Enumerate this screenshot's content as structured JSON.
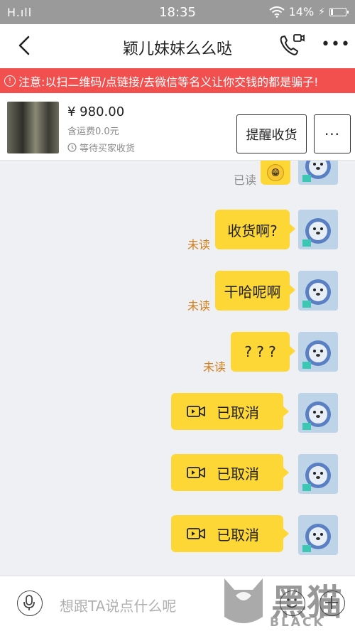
{
  "status_bar": {
    "signal": "H.ıll",
    "time": "18:35",
    "battery": "14%"
  },
  "nav": {
    "title": "颖儿妹妹么么哒"
  },
  "warning": {
    "text": "注意:以扫二维码/点链接/去微信等名义让你交钱的都是骗子!"
  },
  "order": {
    "price": "¥ 980.00",
    "shipping": "含运费0.0元",
    "status": "等待买家收货",
    "remind_button": "提醒收货",
    "more_button": "···"
  },
  "messages": [
    {
      "type": "emoji",
      "read_status": "已读"
    },
    {
      "type": "text",
      "text": "收货啊?",
      "read_status": "未读"
    },
    {
      "type": "text",
      "text": "干哈呢啊",
      "read_status": "未读"
    },
    {
      "type": "text",
      "text": "? ? ?",
      "read_status": "未读"
    },
    {
      "type": "video_call",
      "text": "已取消"
    },
    {
      "type": "video_call",
      "text": "已取消"
    },
    {
      "type": "video_call",
      "text": "已取消"
    }
  ],
  "input": {
    "placeholder": "想跟TA说点什么呢"
  },
  "watermark": {
    "en": "BLACK CAT",
    "cn": "黑猫"
  },
  "colors": {
    "warning_bg": "#f24f4f",
    "bubble": "#fdd736",
    "unread": "#d47f1a"
  }
}
